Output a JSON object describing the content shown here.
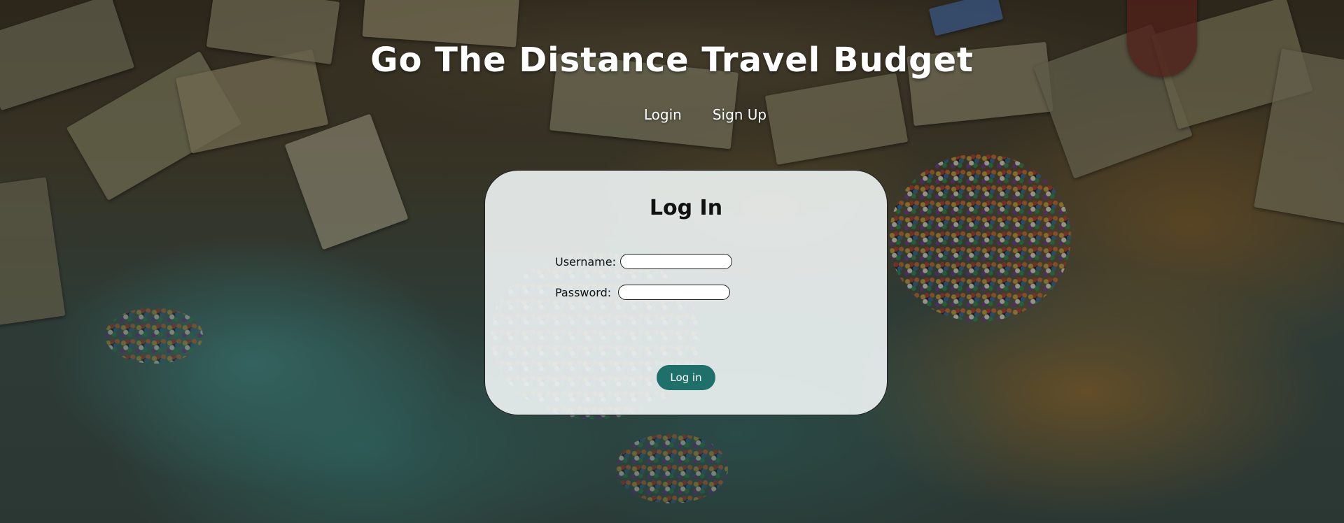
{
  "header": {
    "title": "Go The Distance Travel Budget"
  },
  "nav": {
    "items": [
      {
        "label": "Login"
      },
      {
        "label": "Sign Up"
      }
    ]
  },
  "login_form": {
    "heading": "Log In",
    "username_label": "Username:",
    "username_value": "",
    "password_label": "Password:",
    "password_value": "",
    "submit_label": "Log in"
  },
  "colors": {
    "button_bg": "#1f6f6a",
    "card_bg": "#f5fafa",
    "title_text": "#ffffff"
  }
}
